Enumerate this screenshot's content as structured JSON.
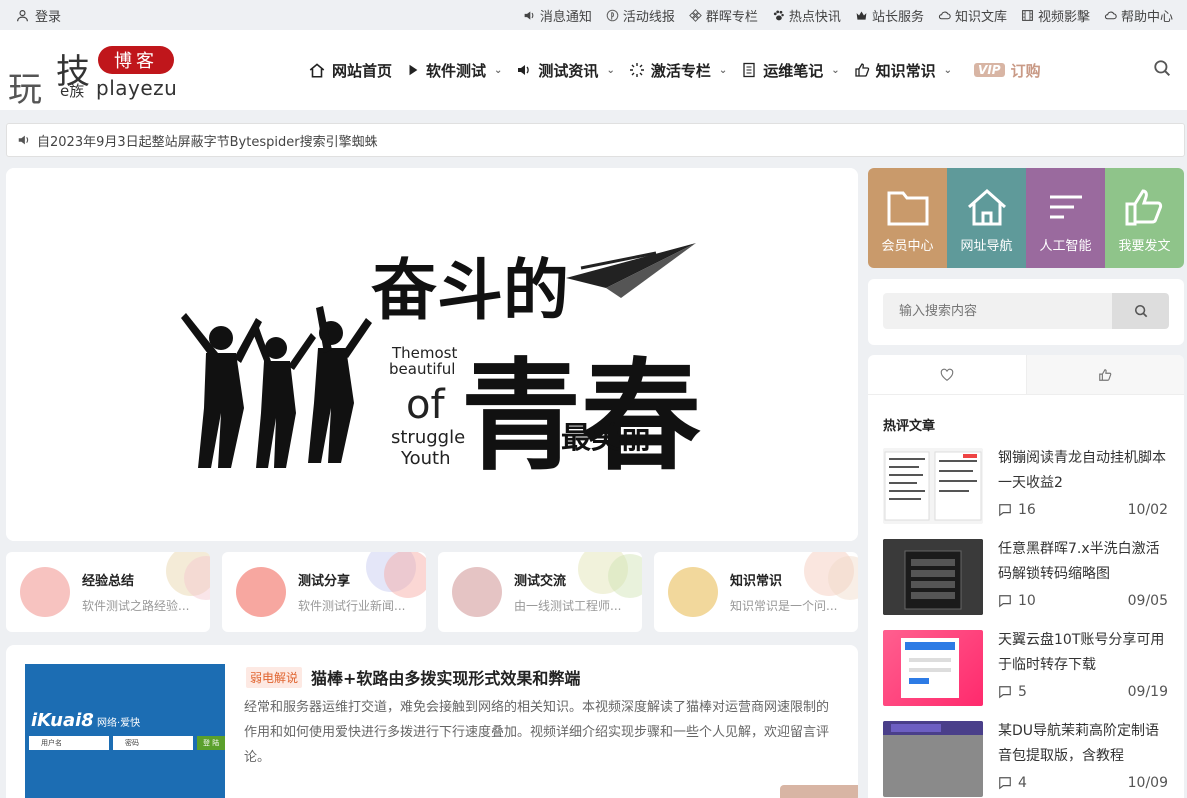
{
  "topbar": {
    "login": "登录",
    "links": [
      "消息通知",
      "活动线报",
      "群晖专栏",
      "热点快讯",
      "站长服务",
      "知识文库",
      "视频影擊",
      "帮助中心"
    ]
  },
  "logo": {
    "wan": "玩",
    "ji": "技",
    "zu": "e族",
    "py": "playezu",
    "bk": "博客"
  },
  "nav": {
    "items": [
      "网站首页",
      "软件测试",
      "测试资讯",
      "激活专栏",
      "运维笔记",
      "知识常识"
    ],
    "vip_badge": "VIP",
    "vip_label": "订购"
  },
  "notice": "自2023年9月3日起整站屏蔽字节Bytespider搜索引擎蜘蛛",
  "banner": {
    "line1": "奋斗的",
    "big": "青春",
    "small": "最美丽",
    "en1": "Themost",
    "en2": "beautiful",
    "en3": "of",
    "en4": "struggle",
    "en5": "Youth"
  },
  "categories": [
    {
      "title": "经验总结",
      "desc": "软件测试之路经验...",
      "color": "#f7c3c0"
    },
    {
      "title": "测试分享",
      "desc": "软件测试行业新闻...",
      "color": "#f7a7a0"
    },
    {
      "title": "测试交流",
      "desc": "由一线测试工程师...",
      "color": "#e5c4c4"
    },
    {
      "title": "知识常识",
      "desc": "知识常识是一个问...",
      "color": "#f2d89c"
    }
  ],
  "article": {
    "tag": "弱电解说",
    "title": "猫棒+软路由多拨实现形式效果和弊端",
    "desc": "经常和服务器运维打交道，难免会接触到网络的相关知识。本视频深度解读了猫棒对运营商网速限制的作用和如何使用爱快进行多拨进行下行速度叠加。视频详细介绍实现步骤和一些个人见解，欢迎留言评论。",
    "thumb_brand": "iKuai8",
    "thumb_slogan": "网络·爱快",
    "thumb_user": "用户名",
    "thumb_pass": "密码",
    "thumb_login": "登 陆"
  },
  "quick": [
    {
      "label": "会员中心",
      "color": "#c99a6b",
      "icon": "folder-icon"
    },
    {
      "label": "网址导航",
      "color": "#5f9a9a",
      "icon": "home-icon"
    },
    {
      "label": "人工智能",
      "color": "#9a6a9e",
      "icon": "list-icon"
    },
    {
      "label": "我要发文",
      "color": "#8fc48a",
      "icon": "thumbs-up-icon"
    }
  ],
  "search": {
    "placeholder": "输入搜索内容"
  },
  "hot": {
    "title": "热评文章",
    "items": [
      {
        "title": "钢镚阅读青龙自动挂机脚本一天收益2",
        "comments": "16",
        "date": "10/02"
      },
      {
        "title": "任意黑群晖7.x半洗白激活码解锁转码缩略图",
        "comments": "10",
        "date": "09/05"
      },
      {
        "title": "天翼云盘10T账号分享可用于临时转存下载",
        "comments": "5",
        "date": "09/19"
      },
      {
        "title": "某DU导航茉莉高阶定制语音包提取版，含教程",
        "comments": "4",
        "date": "10/09"
      }
    ]
  }
}
